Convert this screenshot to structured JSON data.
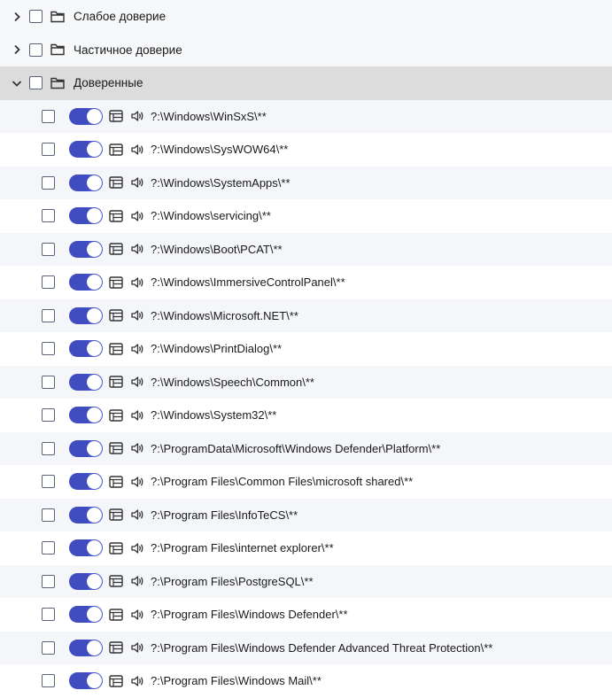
{
  "tree": {
    "folders": [
      {
        "label": "Слабое доверие",
        "expanded": false
      },
      {
        "label": "Частичное доверие",
        "expanded": false
      },
      {
        "label": "Доверенные",
        "expanded": true
      }
    ],
    "items": [
      "?:\\Windows\\WinSxS\\**",
      "?:\\Windows\\SysWOW64\\**",
      "?:\\Windows\\SystemApps\\**",
      "?:\\Windows\\servicing\\**",
      "?:\\Windows\\Boot\\PCAT\\**",
      "?:\\Windows\\ImmersiveControlPanel\\**",
      "?:\\Windows\\Microsoft.NET\\**",
      "?:\\Windows\\PrintDialog\\**",
      "?:\\Windows\\Speech\\Common\\**",
      "?:\\Windows\\System32\\**",
      "?:\\ProgramData\\Microsoft\\Windows Defender\\Platform\\**",
      "?:\\Program Files\\Common Files\\microsoft shared\\**",
      "?:\\Program Files\\InfoTeCS\\**",
      "?:\\Program Files\\internet explorer\\**",
      "?:\\Program Files\\PostgreSQL\\**",
      "?:\\Program Files\\Windows Defender\\**",
      "?:\\Program Files\\Windows Defender Advanced Threat Protection\\**",
      "?:\\Program Files\\Windows Mail\\**"
    ]
  },
  "colors": {
    "toggle_on": "#4a5ad6",
    "expanded_row": "#dcdcdc",
    "stripe": "#f4f6fa"
  },
  "icons": {
    "collapsed": "chevron-right-icon",
    "expanded": "chevron-down-icon",
    "folder": "folder-icon",
    "table": "table-icon",
    "sound": "speaker-icon"
  }
}
